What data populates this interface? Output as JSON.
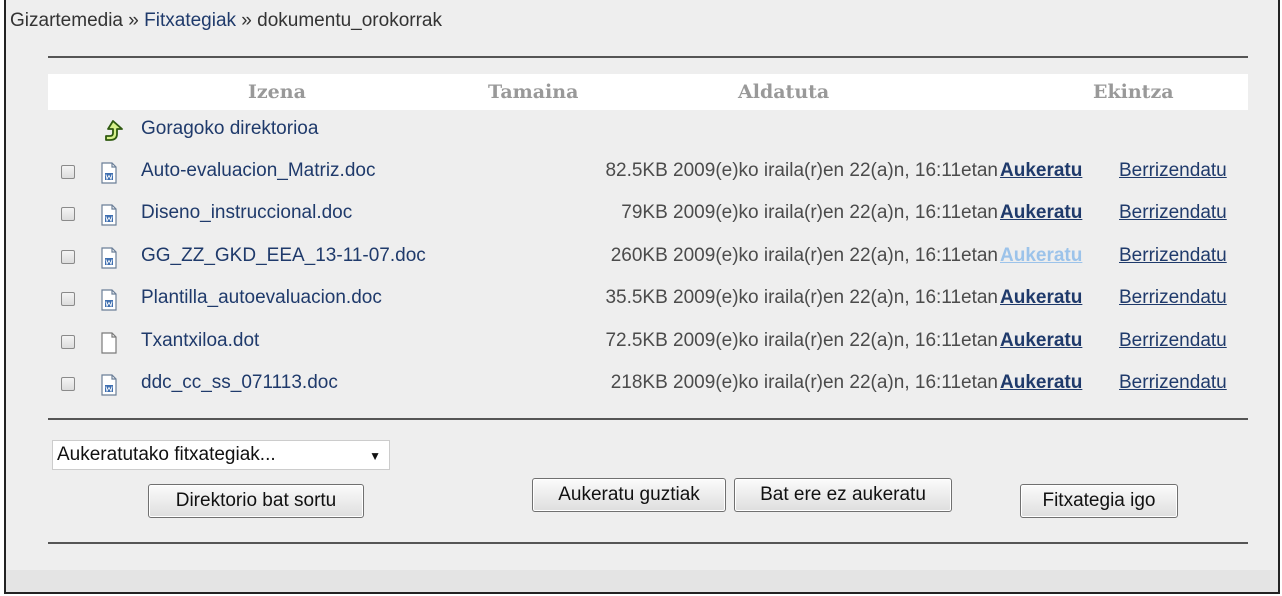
{
  "breadcrumb": {
    "root": "Gizartemedia",
    "sep1": "»",
    "files": "Fitxategiak",
    "sep2": "»",
    "current": "dokumentu_orokorrak"
  },
  "table": {
    "headers": {
      "name": "Izena",
      "size": "Tamaina",
      "modified": "Aldatuta",
      "action": "Ekintza"
    },
    "parent_dir": {
      "label": "Goragoko direktorioa",
      "icon": "parent-folder-icon"
    },
    "choose_label": "Aukeratu",
    "rename_label": "Berrizendatu",
    "rows": [
      {
        "name": "Auto-evaluacion_Matriz.doc",
        "size": "82.5KB",
        "modified": "2009(e)ko iraila(r)en 22(a)n, 16:11etan",
        "icon": "word-document-icon",
        "checked": false,
        "choose_hovered": false
      },
      {
        "name": "Diseno_instruccional.doc",
        "size": "79KB",
        "modified": "2009(e)ko iraila(r)en 22(a)n, 16:11etan",
        "icon": "word-document-icon",
        "checked": false,
        "choose_hovered": false
      },
      {
        "name": "GG_ZZ_GKD_EEA_13-11-07.doc",
        "size": "260KB",
        "modified": "2009(e)ko iraila(r)en 22(a)n, 16:11etan",
        "icon": "word-document-icon",
        "checked": false,
        "choose_hovered": true
      },
      {
        "name": "Plantilla_autoevaluacion.doc",
        "size": "35.5KB",
        "modified": "2009(e)ko iraila(r)en 22(a)n, 16:11etan",
        "icon": "word-document-icon",
        "checked": false,
        "choose_hovered": false
      },
      {
        "name": "Txantxiloa.dot",
        "size": "72.5KB",
        "modified": "2009(e)ko iraila(r)en 22(a)n, 16:11etan",
        "icon": "blank-document-icon",
        "checked": false,
        "choose_hovered": false
      },
      {
        "name": "ddc_cc_ss_071113.doc",
        "size": "218KB",
        "modified": "2009(e)ko iraila(r)en 22(a)n, 16:11etan",
        "icon": "word-document-icon",
        "checked": false,
        "choose_hovered": false
      }
    ]
  },
  "bulk_action": {
    "selected": "Aukeratutako fitxategiak..."
  },
  "buttons": {
    "mkdir": "Direktorio bat sortu",
    "select_all": "Aukeratu guztiak",
    "select_none": "Bat ere ez aukeratu",
    "upload": "Fitxategia igo"
  },
  "colors": {
    "link": "#1f3a6b",
    "link_hover": "#9cc3ea",
    "header_text": "#999999",
    "panel_bg": "#eeeeee"
  }
}
